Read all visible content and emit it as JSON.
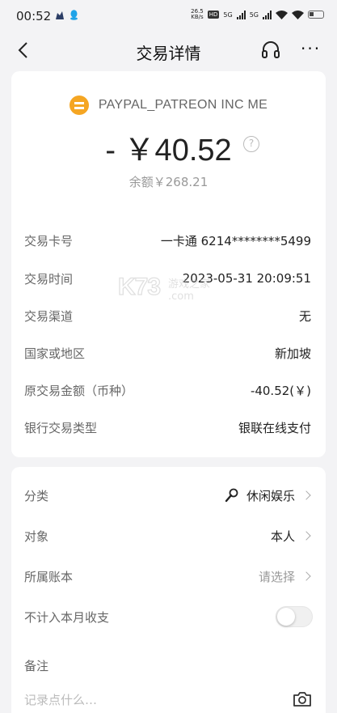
{
  "status_bar": {
    "time": "00:52",
    "net_speed_value": "26.5",
    "net_speed_unit": "KB/s",
    "hd_badge": "HD",
    "signal_1": "5G",
    "signal_2": "5G"
  },
  "nav": {
    "title": "交易详情",
    "more": "···"
  },
  "merchant": {
    "name": "PAYPAL_PATREON INC ME",
    "logo_color": "#f5a623"
  },
  "amount": {
    "value": "- ￥40.52",
    "help": "?"
  },
  "balance": {
    "label": "余额",
    "value": "￥268.21"
  },
  "details": [
    {
      "label": "交易卡号",
      "value": "一卡通 6214********5499"
    },
    {
      "label": "交易时间",
      "value": "2023-05-31 20:09:51"
    },
    {
      "label": "交易渠道",
      "value": "无"
    },
    {
      "label": "国家或地区",
      "value": "新加坡"
    },
    {
      "label": "原交易金额（币种）",
      "value": "-40.52(￥)"
    },
    {
      "label": "银行交易类型",
      "value": "银联在线支付"
    }
  ],
  "watermark": {
    "big": "K73",
    "small": "游戏之家",
    "com": ".com"
  },
  "settings": {
    "category": {
      "label": "分类",
      "value": "休闲娱乐",
      "icon": "microphone-icon"
    },
    "target": {
      "label": "对象",
      "value": "本人"
    },
    "account": {
      "label": "所属账本",
      "value": "请选择"
    },
    "exclude": {
      "label": "不计入本月收支",
      "enabled": false
    },
    "note": {
      "label": "备注",
      "placeholder": "记录点什么…"
    }
  }
}
